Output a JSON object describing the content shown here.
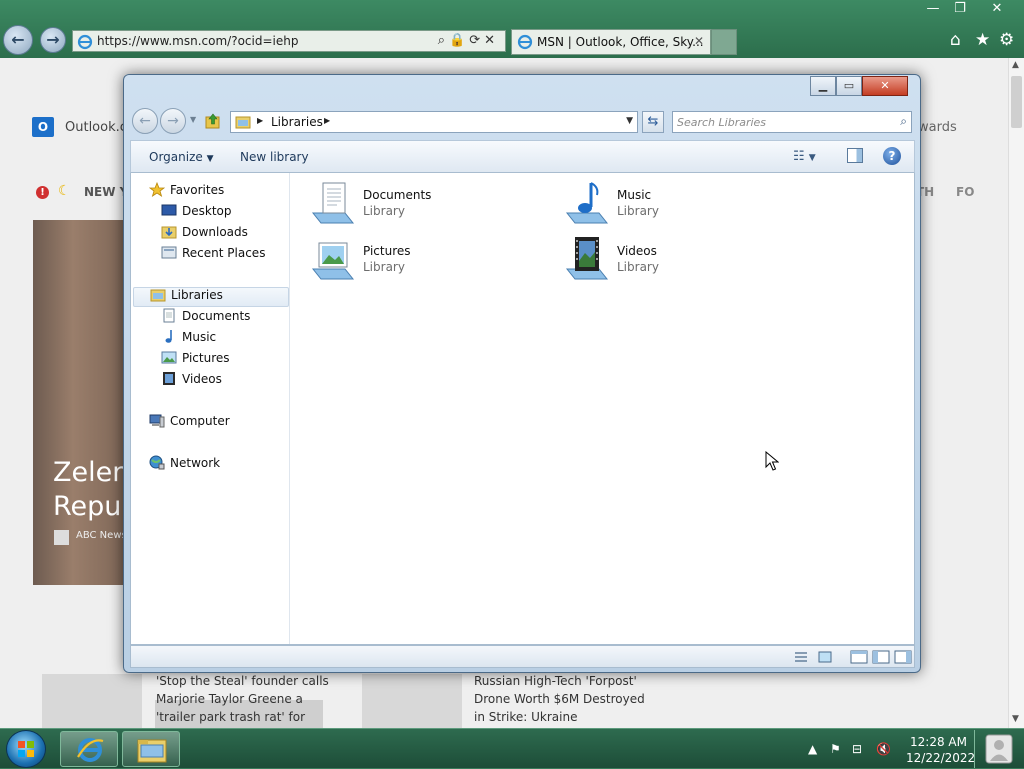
{
  "browser": {
    "address": "https://www.msn.com/?ocid=iehp",
    "tab_title": "MSN | Outlook, Office, Sky...",
    "tab_close": "✕",
    "window_controls": {
      "minimize": "—",
      "restore": "❐",
      "close": "✕"
    },
    "toolbar_icons": [
      "home-icon",
      "favorites-star-icon",
      "settings-gear-icon"
    ]
  },
  "msn_page": {
    "outlook_label": "Outlook.co",
    "outlook_icon_letter": "O",
    "rewards_label": "wards",
    "news_bar_left": "NEW YC",
    "news_bar_right_1": "TH",
    "news_bar_right_2": "FO",
    "hero_title_line1": "Zelens",
    "hero_title_line2": "Repub",
    "hero_source": "ABC News",
    "card_left_text": [
      "'Stop the Steal' founder calls",
      "Marjorie Taylor Greene a",
      "'trailer park trash rat' for"
    ],
    "card_right_text": [
      "Russian High-Tech 'Forpost'",
      "Drone Worth $6M Destroyed",
      "in Strike: Ukraine"
    ]
  },
  "explorer": {
    "path_label": "Libraries",
    "search_placeholder": "Search Libraries",
    "command_bar": {
      "organize_label": "Organize",
      "new_library_label": "New library"
    },
    "nav": {
      "favorites": {
        "label": "Favorites",
        "items": [
          "Desktop",
          "Downloads",
          "Recent Places"
        ]
      },
      "libraries": {
        "label": "Libraries",
        "items": [
          "Documents",
          "Music",
          "Pictures",
          "Videos"
        ]
      },
      "computer": "Computer",
      "network": "Network"
    },
    "libraries": [
      {
        "name": "Documents",
        "type": "Library"
      },
      {
        "name": "Music",
        "type": "Library"
      },
      {
        "name": "Pictures",
        "type": "Library"
      },
      {
        "name": "Videos",
        "type": "Library"
      }
    ]
  },
  "taskbar": {
    "pinned": [
      "internet-explorer-icon",
      "windows-explorer-icon"
    ],
    "clock_time": "12:28 AM",
    "clock_date": "12/22/2022"
  },
  "colors": {
    "taskbar": "#2e6b4f",
    "explorer_frame": "#cfe0f0",
    "close_button": "#c43d23"
  }
}
